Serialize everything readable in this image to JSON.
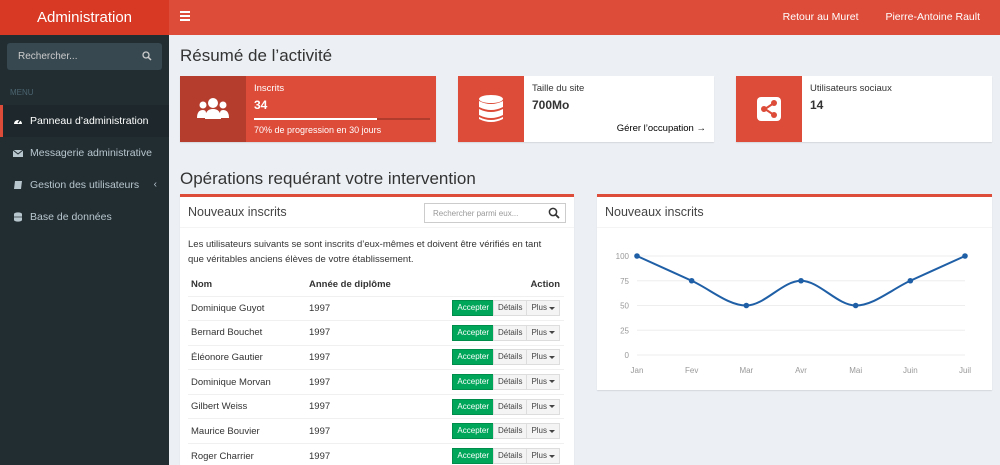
{
  "app": {
    "title": "Administration"
  },
  "top_nav": {
    "back_label": "Retour au Muret",
    "user_name": "Pierre-Antoine Rault"
  },
  "sidebar": {
    "search_placeholder": "Rechercher...",
    "menu_header": "MENU",
    "items": [
      {
        "label": "Panneau d’administration",
        "icon": "dashboard-icon",
        "active": true
      },
      {
        "label": "Messagerie administrative",
        "icon": "envelope-icon"
      },
      {
        "label": "Gestion des utilisateurs",
        "icon": "book-icon",
        "has_submenu": true
      },
      {
        "label": "Base de données",
        "icon": "database-icon"
      }
    ]
  },
  "summary": {
    "title": "Résumé de l’activité",
    "boxes": [
      {
        "label": "Inscrits",
        "value": "34",
        "progress_text": "70% de progression en 30 jours",
        "progress": 0.7,
        "icon": "users-icon"
      },
      {
        "label": "Taille du site",
        "value": "700Mo",
        "link": "Gérer l’occupation",
        "icon": "database-icon"
      },
      {
        "label": "Utilisateurs sociaux",
        "value": "14",
        "icon": "share-icon"
      }
    ]
  },
  "operations": {
    "title": "Opérations requérant votre intervention",
    "signups": {
      "title": "Nouveaux inscrits",
      "search_placeholder": "Rechercher parmi eux...",
      "intro": "Les utilisateurs suivants se sont inscrits d’eux-mêmes et doivent être vérifiés en tant que véritables anciens élèves de votre établissement.",
      "columns": [
        "Nom",
        "Année de diplôme",
        "Action"
      ],
      "rows": [
        {
          "name": "Dominique Guyot",
          "year": "1997"
        },
        {
          "name": "Bernard Bouchet",
          "year": "1997"
        },
        {
          "name": "Éléonore Gautier",
          "year": "1997"
        },
        {
          "name": "Dominique Morvan",
          "year": "1997"
        },
        {
          "name": "Gilbert Weiss",
          "year": "1997"
        },
        {
          "name": "Maurice Bouvier",
          "year": "1997"
        },
        {
          "name": "Roger Charrier",
          "year": "1997"
        }
      ],
      "actions": {
        "accept": "Accepter",
        "details": "Détails",
        "more": "Plus"
      }
    },
    "chart_box": {
      "title": "Nouveaux inscrits"
    }
  },
  "chart_data": {
    "type": "line",
    "categories": [
      "Jan",
      "Fev",
      "Mar",
      "Avr",
      "Mai",
      "Juin",
      "Juil"
    ],
    "values": [
      100,
      75,
      50,
      75,
      50,
      75,
      100
    ],
    "yticks": [
      "0",
      "25",
      "50",
      "75",
      "100"
    ],
    "ylim": [
      0,
      100
    ],
    "color": "#1f5fa6",
    "grid": true
  },
  "colors": {
    "accent": "#dd4b39",
    "sidebar": "#222d32",
    "success": "#00a65a"
  }
}
